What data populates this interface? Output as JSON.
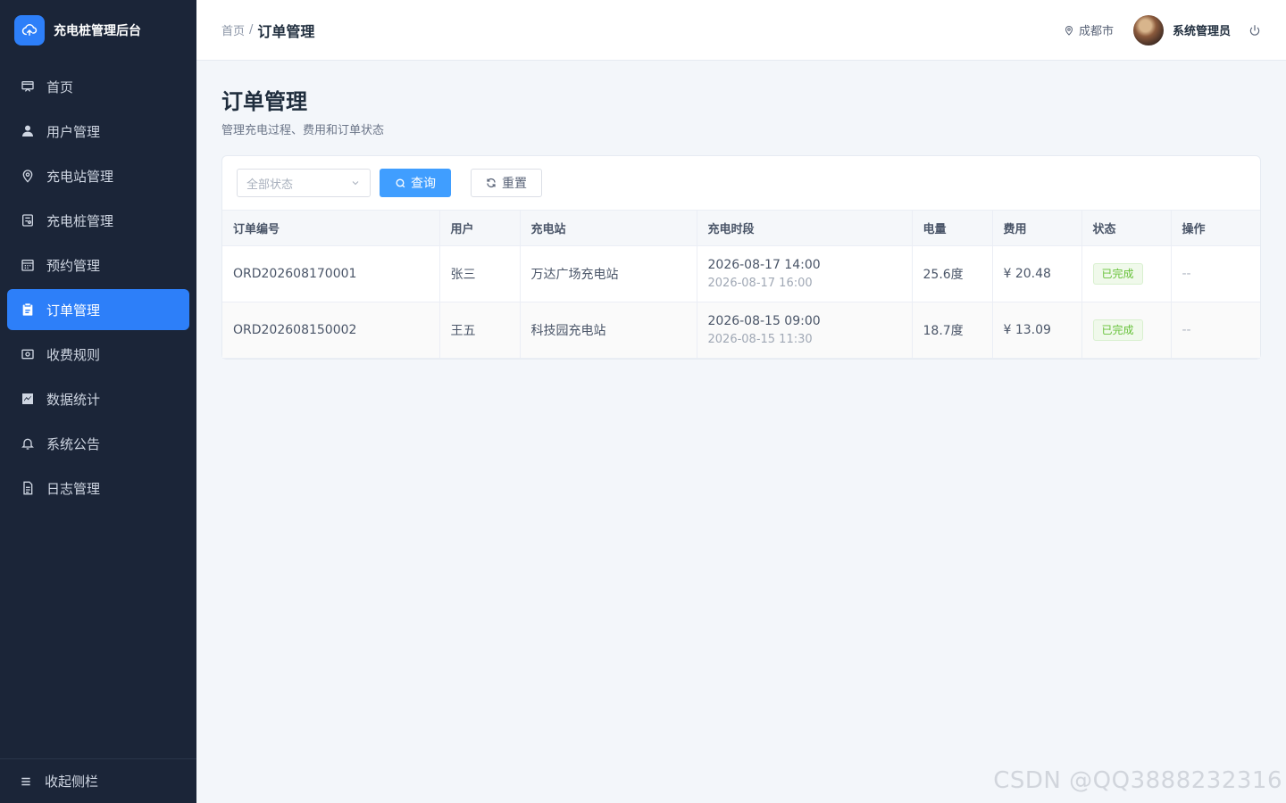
{
  "brand": {
    "title": "充电桩管理后台"
  },
  "sidebar": {
    "items": [
      {
        "label": "首页",
        "icon": "dashboard-icon",
        "active": false
      },
      {
        "label": "用户管理",
        "icon": "user-icon",
        "active": false
      },
      {
        "label": "充电站管理",
        "icon": "location-icon",
        "active": false
      },
      {
        "label": "充电桩管理",
        "icon": "charger-icon",
        "active": false
      },
      {
        "label": "预约管理",
        "icon": "calendar-icon",
        "active": false
      },
      {
        "label": "订单管理",
        "icon": "clipboard-icon",
        "active": true
      },
      {
        "label": "收费规则",
        "icon": "money-icon",
        "active": false
      },
      {
        "label": "数据统计",
        "icon": "chart-icon",
        "active": false
      },
      {
        "label": "系统公告",
        "icon": "bell-icon",
        "active": false
      },
      {
        "label": "日志管理",
        "icon": "document-icon",
        "active": false
      }
    ],
    "collapse_label": "收起侧栏"
  },
  "header": {
    "breadcrumb_home": "首页",
    "breadcrumb_sep": "/",
    "breadcrumb_current": "订单管理",
    "location": "成都市",
    "username": "系统管理员"
  },
  "page": {
    "title": "订单管理",
    "subtitle": "管理充电过程、费用和订单状态"
  },
  "filters": {
    "status_placeholder": "全部状态",
    "search_label": "查询",
    "reset_label": "重置"
  },
  "table": {
    "columns": [
      "订单编号",
      "用户",
      "充电站",
      "充电时段",
      "电量",
      "费用",
      "状态",
      "操作"
    ],
    "rows": [
      {
        "order_no": "ORD202608170001",
        "user": "张三",
        "station": "万达广场充电站",
        "start": "2026-08-17 14:00",
        "end": "2026-08-17 16:00",
        "energy": "25.6度",
        "fee": "¥ 20.48",
        "status": "已完成",
        "op": "--"
      },
      {
        "order_no": "ORD202608150002",
        "user": "王五",
        "station": "科技园充电站",
        "start": "2026-08-15 09:00",
        "end": "2026-08-15 11:30",
        "energy": "18.7度",
        "fee": "¥ 13.09",
        "status": "已完成",
        "op": "--"
      }
    ]
  },
  "watermark": "CSDN @QQ3888232316",
  "colors": {
    "sidebar_bg": "#1b2538",
    "accent": "#2d7ff9",
    "primary_button": "#409eff",
    "success": "#67c23a"
  }
}
